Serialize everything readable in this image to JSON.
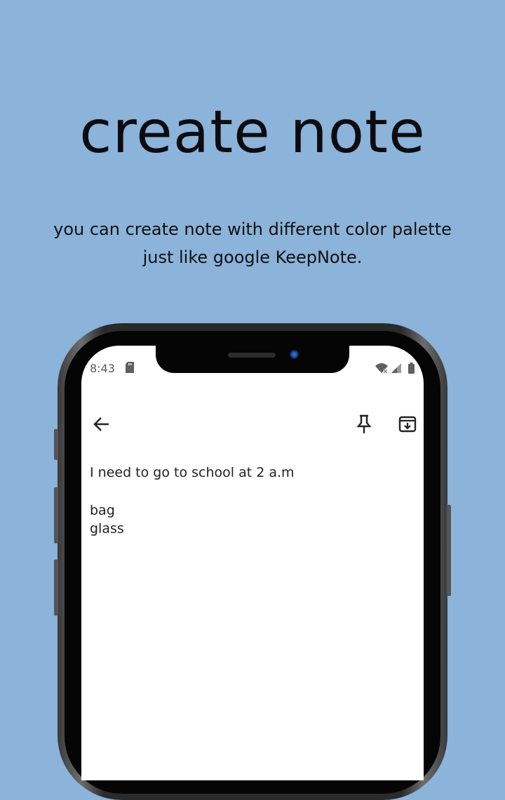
{
  "promo": {
    "title": "create note",
    "subtitle_line1": "you can create note with different color palette",
    "subtitle_line2": "just like google KeepNote."
  },
  "status_bar": {
    "time": "8:43",
    "icons": [
      "sd-card-icon",
      "wifi-icon",
      "cell-signal-icon",
      "battery-icon"
    ]
  },
  "toolbar": {
    "icons": [
      "back-arrow-icon",
      "pin-icon",
      "archive-icon"
    ]
  },
  "note": {
    "line1": "I need to go to school at 2 a.m",
    "line2": "bag",
    "line3": "glass"
  },
  "colors": {
    "background": "#8cb3d9",
    "screen": "#ffffff",
    "text": "#222222"
  }
}
